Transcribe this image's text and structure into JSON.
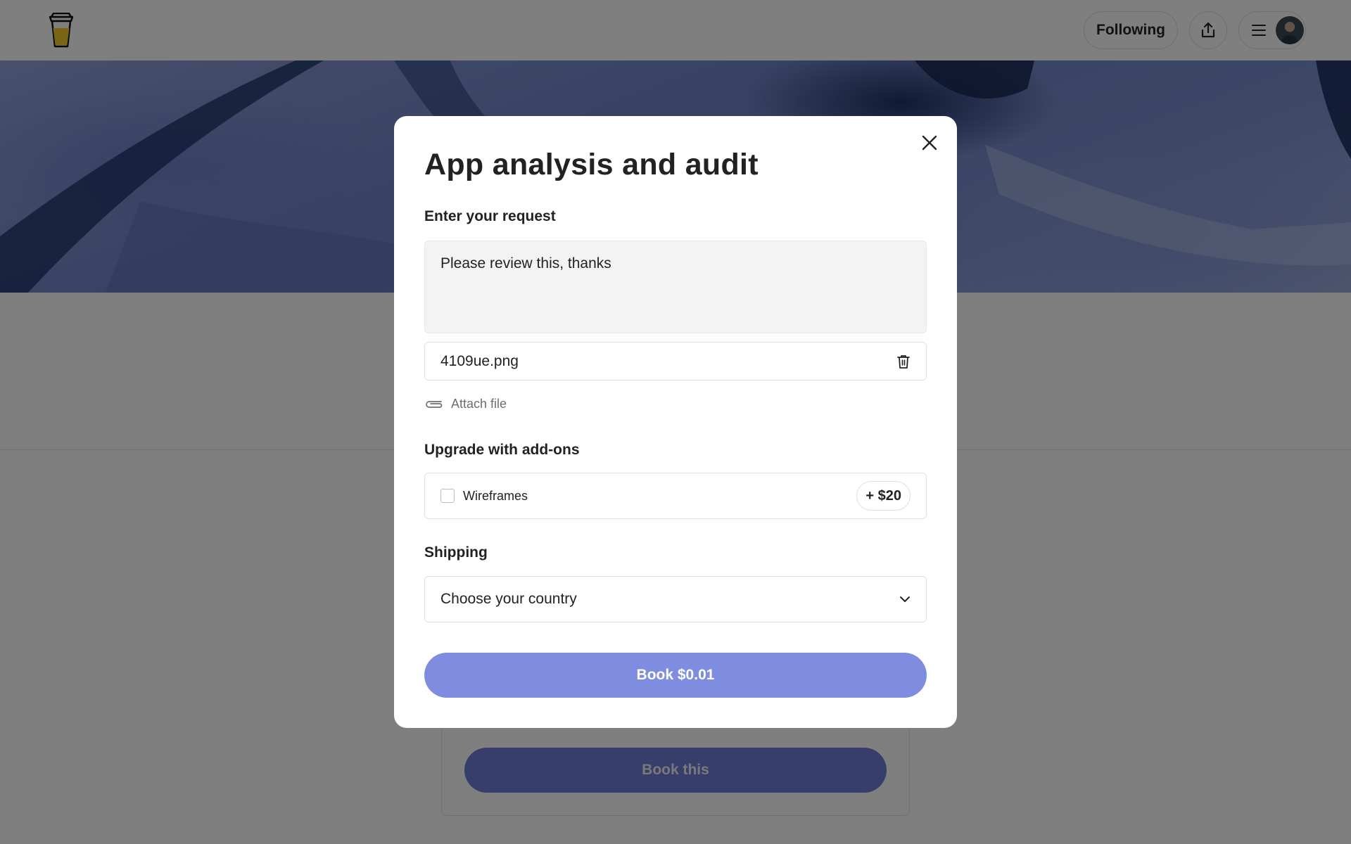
{
  "header": {
    "following_label": "Following",
    "share_icon": "share-upload-icon",
    "menu_icon": "hamburger-menu-icon",
    "avatar": "user-avatar"
  },
  "page": {
    "book_this_label": "Book this"
  },
  "modal": {
    "title": "App analysis and audit",
    "request_label": "Enter your request",
    "request_value": "Please review this, thanks",
    "attached_file": "4109ue.png",
    "attach_label": "Attach file",
    "addons_label": "Upgrade with add-ons",
    "addons": [
      {
        "name": "Wireframes",
        "price": "+ $20",
        "checked": false
      }
    ],
    "shipping_label": "Shipping",
    "country_placeholder": "Choose your country",
    "book_label": "Book $0.01"
  },
  "colors": {
    "accent": "#7f8de1",
    "overlay": "rgba(0,0,0,0.5)"
  }
}
